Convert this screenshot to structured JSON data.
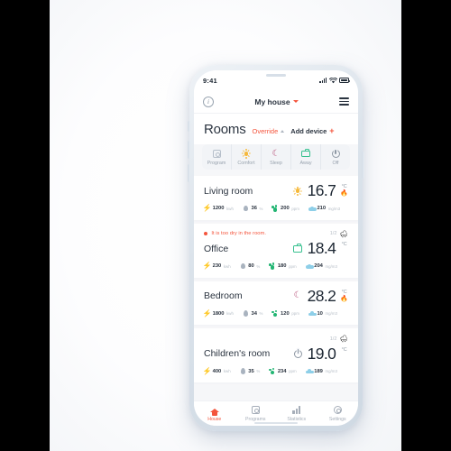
{
  "status_bar": {
    "time": "9:41",
    "signal_icon": "cellular-signal-icon",
    "wifi_icon": "wifi-icon",
    "battery_icon": "battery-full-icon"
  },
  "app_header": {
    "info_icon": "info-icon",
    "info_glyph": "i",
    "title": "My house",
    "chevron_icon": "chevron-down-icon",
    "menu_icon": "hamburger-menu-icon"
  },
  "page": {
    "title": "Rooms",
    "override_label": "Override",
    "override_chevron": "chevron-up-icon",
    "add_device_label": "Add device",
    "add_device_plus": "+"
  },
  "modes": [
    {
      "label": "Program",
      "icon": "calendar-program-icon",
      "color": "#b6bfca"
    },
    {
      "label": "Comfort",
      "icon": "sun-icon",
      "color": "#f6b93b"
    },
    {
      "label": "Sleep",
      "icon": "moon-icon",
      "glyph": "☾",
      "color": "#b8527a"
    },
    {
      "label": "Away",
      "icon": "briefcase-icon",
      "color": "#35c08e"
    },
    {
      "label": "Off",
      "icon": "power-icon",
      "color": "#8d97a3"
    }
  ],
  "metric_units": {
    "energy": "kwh",
    "humidity": "%",
    "co2": "ppm",
    "particles": "mg/m3"
  },
  "rooms": [
    {
      "name": "Living room",
      "mode_icon": "sun-icon",
      "temperature": "16.7",
      "unit": "°C",
      "heating": true,
      "warning": null,
      "metrics": {
        "energy": "1200",
        "humidity": "36",
        "co2": "200",
        "particles": "210"
      }
    },
    {
      "name": "Office",
      "mode_icon": "briefcase-icon",
      "temperature": "18.4",
      "unit": "°C",
      "heating": false,
      "warning": {
        "text": "It is too dry in the room.",
        "count": "1/2",
        "icon": "alert-humidity-icon"
      },
      "metrics": {
        "energy": "230",
        "humidity": "80",
        "co2": "180",
        "particles": "204"
      }
    },
    {
      "name": "Bedroom",
      "mode_icon": "moon-icon",
      "temperature": "28.2",
      "unit": "°C",
      "heating": true,
      "warning": null,
      "metrics": {
        "energy": "1800",
        "humidity": "34",
        "co2": "120",
        "particles": "10"
      }
    },
    {
      "name": "Children's room",
      "mode_icon": "power-icon",
      "temperature": "19.0",
      "unit": "°C",
      "heating": false,
      "warning": {
        "text": "",
        "count": "1/2",
        "icon": "alert-humidity-icon"
      },
      "metrics": {
        "energy": "400",
        "humidity": "35",
        "co2": "234",
        "particles": "189"
      }
    }
  ],
  "tabs": [
    {
      "label": "House",
      "icon": "home-icon",
      "active": true
    },
    {
      "label": "Programs",
      "icon": "calendar-program-icon",
      "active": false
    },
    {
      "label": "Statistics",
      "icon": "bar-chart-icon",
      "active": false
    },
    {
      "label": "Settings",
      "icon": "gear-icon",
      "active": false
    }
  ],
  "colors": {
    "accent": "#f4553d",
    "sun": "#f6b93b",
    "away": "#35c08e",
    "sleep": "#b8527a",
    "co2": "#22b573",
    "cloud": "#8ecfe8",
    "bolt": "#f5a623",
    "text": "#2b3440",
    "muted": "#b9c0c9",
    "screen_bg": "#f6f7f9"
  }
}
